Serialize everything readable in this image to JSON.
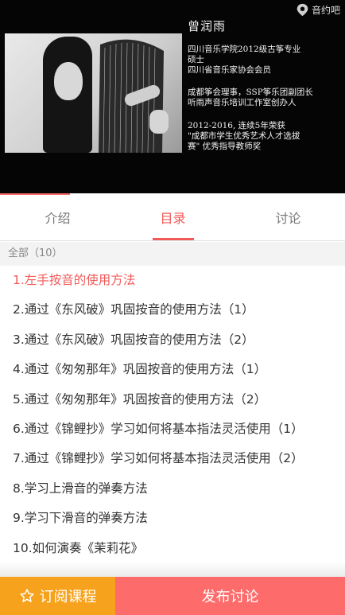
{
  "hero": {
    "brand": "音约吧",
    "name": "曾润雨",
    "lines1": [
      "四川音乐学院2012级古筝专业",
      "硕士",
      "四川省音乐家协会会员"
    ],
    "lines2": [
      "成都筝会理事，SSP筝乐团副团长",
      "听雨声音乐培训工作室创办人"
    ],
    "lines3": [
      "2012-2016, 连续5年荣获",
      "\"成都市学生优秀艺术人才选拔",
      "赛\" 优秀指导教师奖"
    ]
  },
  "tabs": [
    {
      "label": "介绍",
      "active": false
    },
    {
      "label": "目录",
      "active": true
    },
    {
      "label": "讨论",
      "active": false
    }
  ],
  "filter": {
    "label": "全部（10）"
  },
  "lessons": [
    {
      "title": "1.左手按音的使用方法",
      "active": true
    },
    {
      "title": "2.通过《东风破》巩固按音的使用方法（1）",
      "active": false
    },
    {
      "title": "3.通过《东风破》巩固按音的使用方法（2）",
      "active": false
    },
    {
      "title": "4.通过《匆匆那年》巩固按音的使用方法（1）",
      "active": false
    },
    {
      "title": "5.通过《匆匆那年》巩固按音的使用方法（2）",
      "active": false
    },
    {
      "title": "6.通过《锦鲤抄》学习如何将基本指法灵活使用（1）",
      "active": false
    },
    {
      "title": "7.通过《锦鲤抄》学习如何将基本指法灵活使用（2）",
      "active": false
    },
    {
      "title": "8.学习上滑音的弹奏方法",
      "active": false
    },
    {
      "title": "9.学习下滑音的弹奏方法",
      "active": false
    },
    {
      "title": "10.如何演奏《茉莉花》",
      "active": false
    }
  ],
  "bottom": {
    "subscribe_label": "订阅课程",
    "post_label": "发布讨论"
  },
  "icons": {
    "subscribe": "star-outline-icon",
    "brand": "location-pin-icon"
  },
  "colors": {
    "accent": "#f25a5a",
    "subscribe_bg": "#f7a21c",
    "post_bg": "#fe6b6b"
  }
}
